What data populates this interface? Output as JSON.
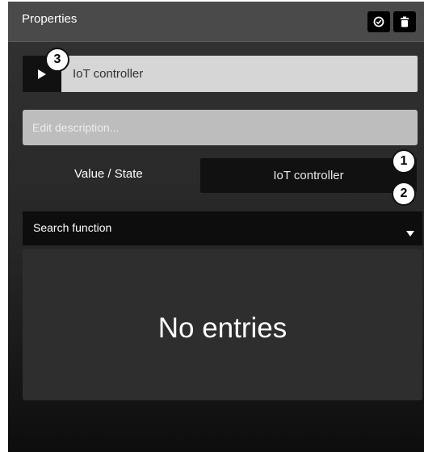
{
  "header": {
    "title": "Properties",
    "buttons": [
      {
        "name": "toggle",
        "icon": "toggle-circle-icon"
      },
      {
        "name": "delete",
        "icon": "trash-icon"
      }
    ]
  },
  "object": {
    "name": "IoT controller",
    "play_icon": "play-icon"
  },
  "description": {
    "placeholder": "Edit description...",
    "value": ""
  },
  "value_state": {
    "label": "Value / State",
    "button_label": "IoT controller"
  },
  "search": {
    "label": "Search function",
    "icon": "chevron-down-icon"
  },
  "list": {
    "empty_text": "No entries"
  },
  "callouts": [
    "1",
    "2",
    "3"
  ],
  "colors": {
    "header_bg": "#4a4a4a",
    "panel_bg": "#2b2b2b",
    "button_bg": "#111111",
    "field_bg": "#bdbdbd"
  }
}
